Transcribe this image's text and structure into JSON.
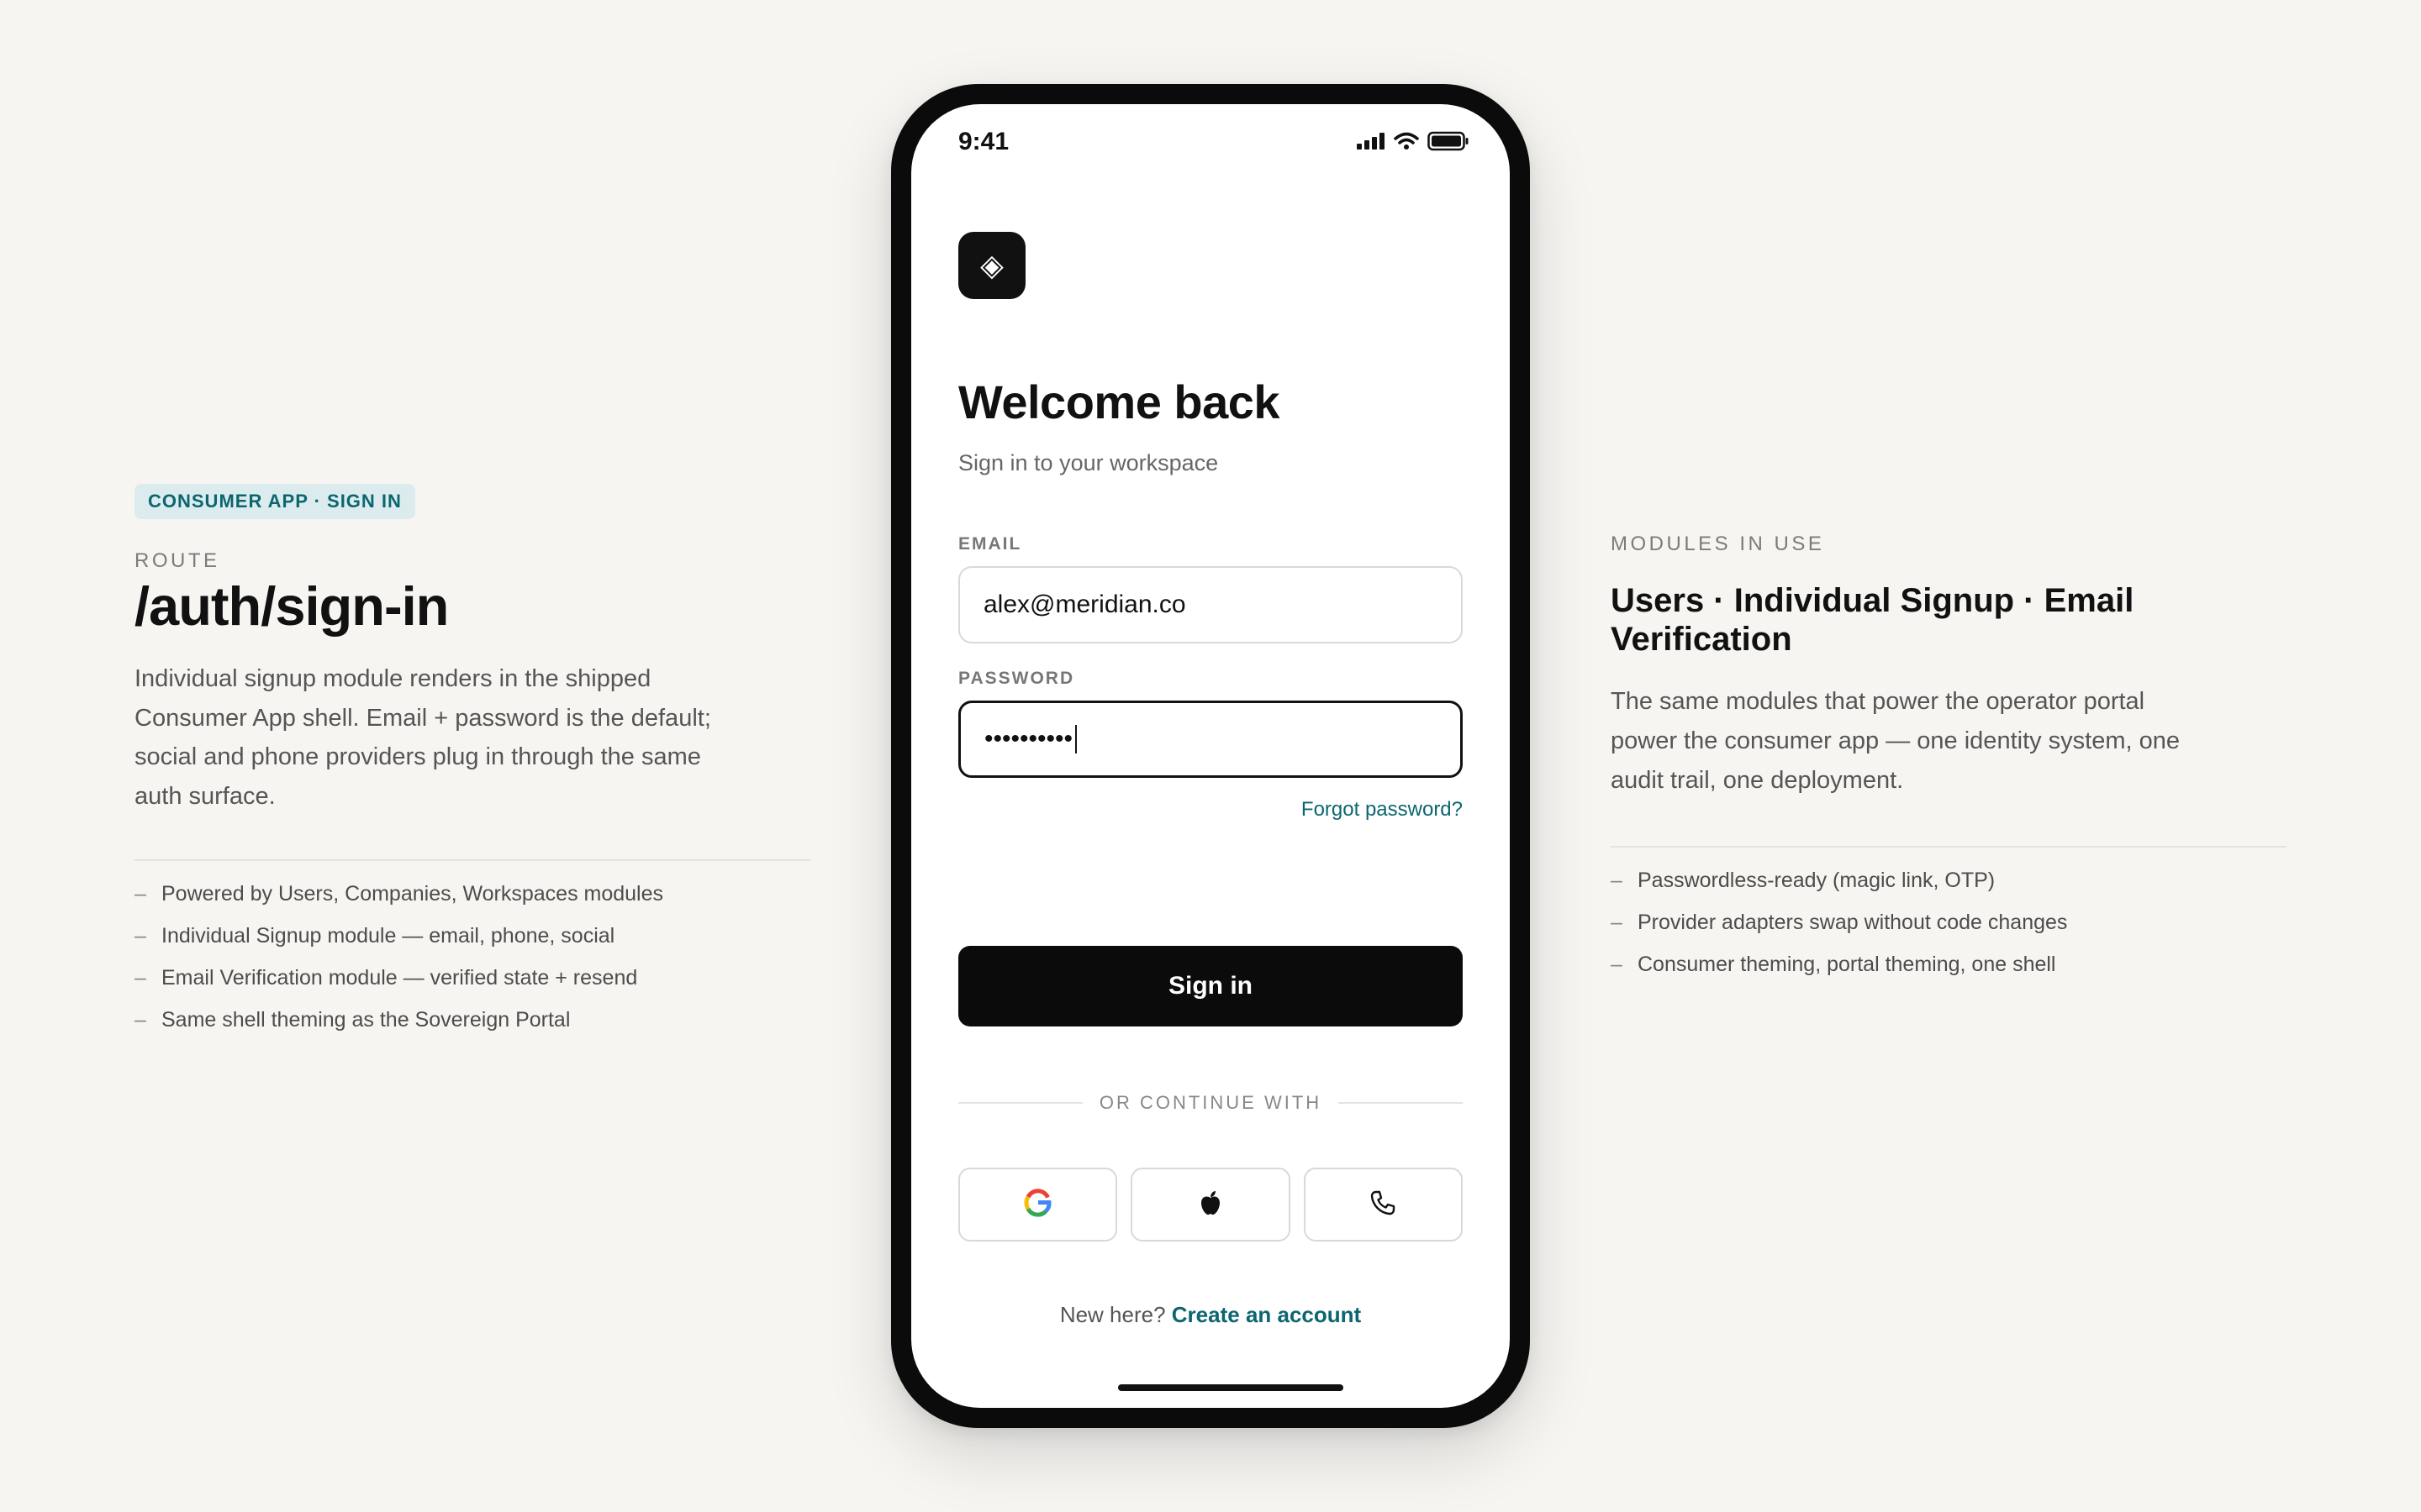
{
  "left": {
    "badge": "CONSUMER APP · SIGN IN",
    "eyebrow": "ROUTE",
    "route": "/auth/sign-in",
    "description": "Individual signup module renders in the shipped Consumer App shell. Email + password is the default; social and phone providers plug in through the same auth surface.",
    "bullets": [
      "Powered by Users, Companies, Workspaces modules",
      "Individual Signup module — email, phone, social",
      "Email Verification module — verified state + resend",
      "Same shell theming as the Sovereign Portal"
    ]
  },
  "right": {
    "eyebrow": "MODULES IN USE",
    "title": "Users · Individual Signup · Email Verification",
    "description": "The same modules that power the operator portal power the consumer app — one identity system, one audit trail, one deployment.",
    "bullets": [
      "Passwordless-ready (magic link, OTP)",
      "Provider adapters swap without code changes",
      "Consumer theming, portal theming, one shell"
    ]
  },
  "phone": {
    "status_time": "9:41",
    "status_icons": [
      "signal-icon",
      "wifi-icon",
      "battery-icon"
    ],
    "logo_icon": "diamond-logo-icon",
    "logo_glyph": "◈",
    "welcome": "Welcome back",
    "subtitle": "Sign in to your workspace",
    "email_label": "EMAIL",
    "email_value": "alex@meridian.co",
    "password_label": "PASSWORD",
    "password_value": "••••••••••",
    "forgot": "Forgot password?",
    "signin_label": "Sign in",
    "divider_text": "OR CONTINUE WITH",
    "social_icons": [
      "google-icon",
      "apple-icon",
      "phone-icon"
    ],
    "new_here": "New here?",
    "create_account": "Create an account"
  },
  "colors": {
    "background": "#f6f5f2",
    "accent": "#0c6670",
    "badge_bg": "#dcecee",
    "primary_button": "#0b0b0b"
  }
}
